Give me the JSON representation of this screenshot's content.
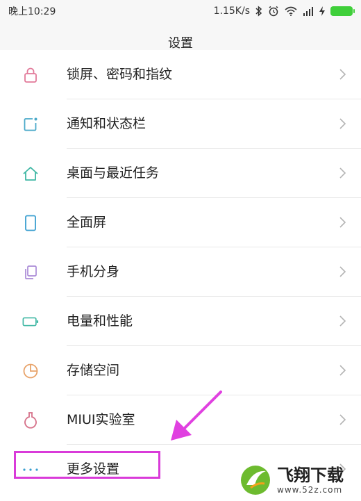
{
  "status_bar": {
    "time": "晚上10:29",
    "net_speed": "1.15K/s"
  },
  "header": {
    "title": "设置"
  },
  "settings_items": [
    {
      "label": "锁屏、密码和指纹",
      "icon": "lock-icon",
      "icon_color": "#e27a9a"
    },
    {
      "label": "通知和状态栏",
      "icon": "notification-icon",
      "icon_color": "#4aa9c9"
    },
    {
      "label": "桌面与最近任务",
      "icon": "home-icon",
      "icon_color": "#3fb7a4"
    },
    {
      "label": "全面屏",
      "icon": "phone-screen-icon",
      "icon_color": "#3a9fd0"
    },
    {
      "label": "手机分身",
      "icon": "dual-space-icon",
      "icon_color": "#a98ad6"
    },
    {
      "label": "电量和性能",
      "icon": "battery-icon",
      "icon_color": "#3fb7a4"
    },
    {
      "label": "存储空间",
      "icon": "storage-pie-icon",
      "icon_color": "#e8a36a"
    },
    {
      "label": "MIUI实验室",
      "icon": "lab-flask-icon",
      "icon_color": "#d6728a"
    },
    {
      "label": "更多设置",
      "icon": "more-dots-icon",
      "icon_color": "#3a9fd0"
    }
  ],
  "annotation": {
    "highlight_color": "#d93bd9"
  },
  "watermark": {
    "brand": "飞翔下载",
    "url": "www.52z.com"
  }
}
